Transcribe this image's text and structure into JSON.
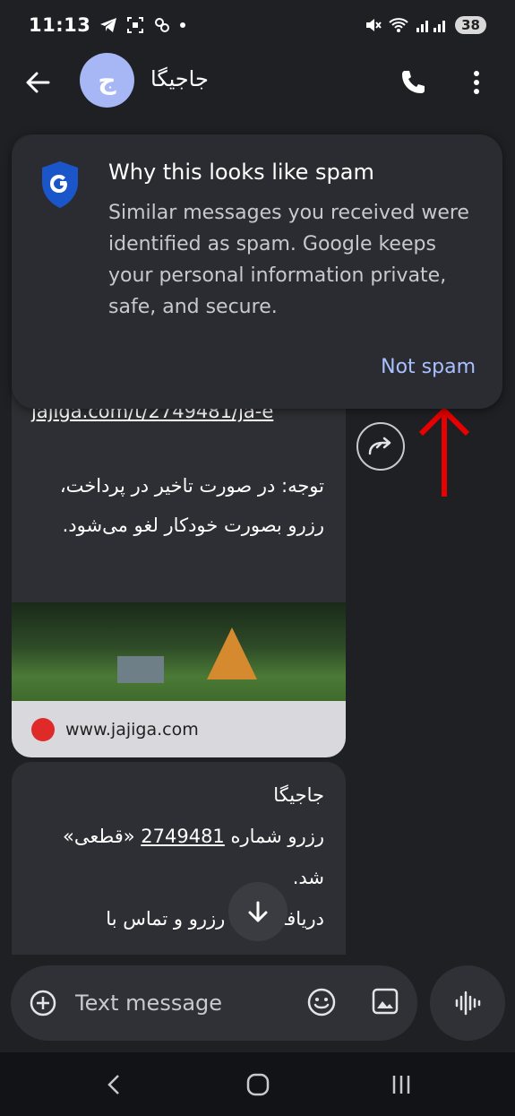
{
  "status_bar": {
    "time": "11:13",
    "battery": "38"
  },
  "header": {
    "avatar_letter": "ج",
    "title": "جاجیگا"
  },
  "spam_popup": {
    "title": "Why this looks like spam",
    "body": "Similar messages you received were identified as spam. Google keeps your personal information private, safe, and secure.",
    "not_spam_label": "Not spam"
  },
  "message1": {
    "link_fragment": "jajiga.com/t/2749481/ja-e",
    "text": "توجه: در صورت تاخیر در پرداخت، رزرو بصورت خودکار لغو می‌شود.",
    "link_preview_domain": "www.jajiga.com"
  },
  "message2": {
    "line1": "جاجیگا",
    "line2_prefix": "رزرو شماره ",
    "reservation_number": "2749481",
    "line2_suffix": " «قطعی»",
    "line3": "شد.",
    "line4": "دریافت سند رزرو و تماس با"
  },
  "composer": {
    "placeholder": "Text message"
  },
  "colors": {
    "background": "#1f2024",
    "accent_link": "#a8c0ff",
    "avatar": "#a7b6f5",
    "annotation_arrow": "#e60000"
  }
}
